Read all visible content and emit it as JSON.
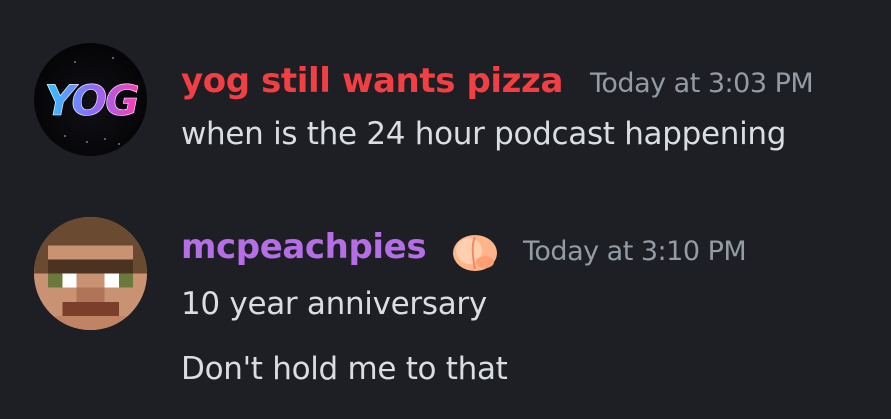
{
  "messages": [
    {
      "author": "yog still wants pizza",
      "author_color": "#f23f43",
      "timestamp": "Today at 3:03 PM",
      "avatar_icon": "yog-logo-avatar",
      "avatar_text": "YOG",
      "lines": [
        "when is the 24 hour podcast happening"
      ]
    },
    {
      "author": "mcpeachpies",
      "author_color": "#b56ee6",
      "author_badge_icon": "peach-emoji",
      "timestamp": "Today at 3:10 PM",
      "avatar_icon": "pixel-face-avatar",
      "lines": [
        "10 year anniversary",
        "Don't hold me to that"
      ]
    }
  ],
  "colors": {
    "background": "#1e1f24",
    "text": "#dbdee1",
    "timestamp": "#949ba4"
  }
}
